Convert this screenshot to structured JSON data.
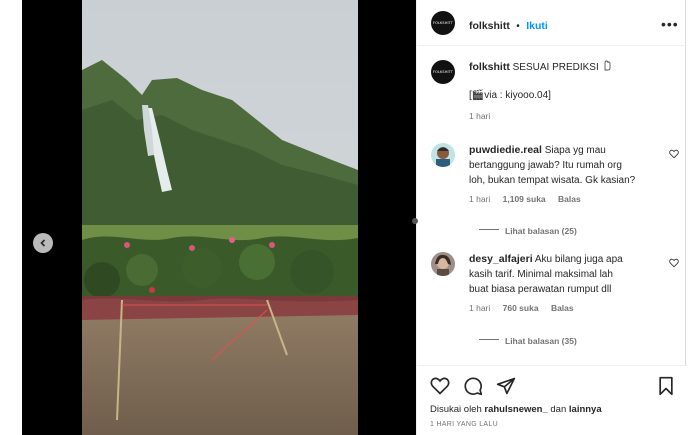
{
  "post": {
    "author": "folkshitt",
    "avatar_text": "FOLKSHITT",
    "follow_separator": "•",
    "follow_label": "Ikuti",
    "more_icon": "more-horizontal-icon"
  },
  "caption": {
    "author": "folkshitt",
    "text": " SESUAI PREDIKSI",
    "emoji_hand": "hand-emoji",
    "credit": "[🎬via : kiyooo.04]",
    "time": "1 hari"
  },
  "comments": [
    {
      "username": "puwdiedie.real",
      "line1": " Siapa yg mau",
      "line2": "bertanggung jawab? Itu rumah org",
      "line3": "loh, bukan tempat wisata. Gk kasian?",
      "time": "1 hari",
      "likes": "1,109 suka",
      "reply": "Balas",
      "view_replies": "Lihat balasan (25)"
    },
    {
      "username": "desy_alfajeri",
      "line1": " Aku bilang juga apa",
      "line2": "kasih tarif. Minimal maksimal lah",
      "line3": "buat biasa perawatan rumput dll",
      "time": "1 hari",
      "likes": "760 suka",
      "reply": "Balas",
      "view_replies": "Lihat balasan (35)"
    }
  ],
  "footer": {
    "liked_prefix": "Disukai oleh ",
    "liked_user": "rahulsnewen_",
    "liked_and": " dan ",
    "liked_others": "lainnya",
    "time_ago": "1 HARI YANG LALU"
  },
  "colors": {
    "link_blue": "#0095f6",
    "text": "#262626",
    "secondary": "#737373"
  }
}
